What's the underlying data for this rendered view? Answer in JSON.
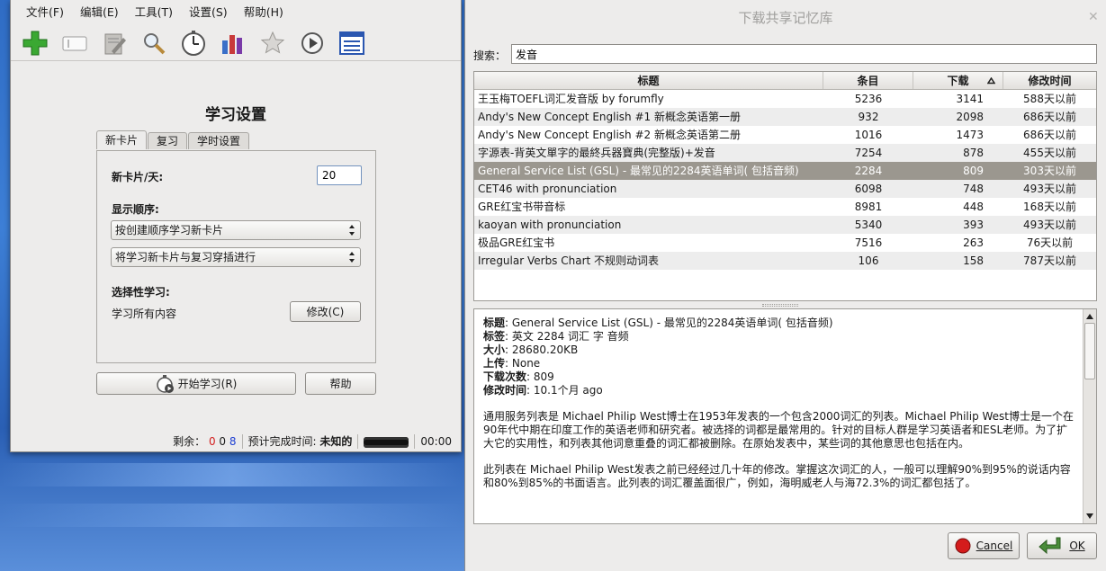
{
  "left_window": {
    "menu": [
      "文件(F)",
      "编辑(E)",
      "工具(T)",
      "设置(S)",
      "帮助(H)"
    ],
    "toolbar_icons": [
      "add-icon",
      "card-icon",
      "edit-icon",
      "search-icon",
      "timer-icon",
      "stats-icon",
      "star-icon",
      "play-icon",
      "list-icon"
    ],
    "title": "学习设置",
    "tabs": [
      "新卡片",
      "复习",
      "学时设置"
    ],
    "new_cards_label": "新卡片/天:",
    "new_cards_value": "20",
    "order_label": "显示顺序:",
    "order_option_1": "按创建顺序学习新卡片",
    "order_option_2": "将学习新卡片与复习穿插进行",
    "selective_label": "选择性学习:",
    "selective_value": "学习所有内容",
    "modify_button": "修改(C)",
    "start_button": "开始学习(R)",
    "help_button": "帮助",
    "status": {
      "remaining_label": "剩余：",
      "remaining_red": "0",
      "remaining_mid": "0",
      "remaining_blue": "8",
      "eta_label": "预计完成时间:",
      "eta_value": "未知的",
      "time": "00:00"
    }
  },
  "dialog": {
    "title": "下载共享记忆库",
    "search_label": "搜索：",
    "search_value": "发音",
    "columns": [
      "标题",
      "条目",
      "下载",
      "修改时间"
    ],
    "rows": [
      {
        "title": "王玉梅TOEFL词汇发音版 by forumfly",
        "count": "5236",
        "downloads": "3141",
        "modified": "588天以前"
      },
      {
        "title": "Andy's New Concept English #1 新概念英语第一册",
        "count": "932",
        "downloads": "2098",
        "modified": "686天以前"
      },
      {
        "title": "Andy's New Concept English #2 新概念英语第二册",
        "count": "1016",
        "downloads": "1473",
        "modified": "686天以前"
      },
      {
        "title": "字源表-背英文單字的最終兵器寶典(完整版)+发音",
        "count": "7254",
        "downloads": "878",
        "modified": "455天以前"
      },
      {
        "title": "General Service List (GSL) - 最常见的2284英语单词( 包括音频)",
        "count": "2284",
        "downloads": "809",
        "modified": "303天以前"
      },
      {
        "title": "CET46 with pronunciation",
        "count": "6098",
        "downloads": "748",
        "modified": "493天以前"
      },
      {
        "title": "GRE红宝书带音标",
        "count": "8981",
        "downloads": "448",
        "modified": "168天以前"
      },
      {
        "title": "kaoyan with pronunciation",
        "count": "5340",
        "downloads": "393",
        "modified": "493天以前"
      },
      {
        "title": "极品GRE红宝书",
        "count": "7516",
        "downloads": "263",
        "modified": "76天以前"
      },
      {
        "title": "Irregular Verbs Chart 不规则动词表",
        "count": "106",
        "downloads": "158",
        "modified": "787天以前"
      }
    ],
    "selected_row": 4,
    "details": {
      "title_label": "标题",
      "title_value": "General Service List (GSL) - 最常见的2284英语单词( 包括音频)",
      "tags_label": "标签",
      "tags_value": "英文 2284 词汇 字 音频",
      "size_label": "大小",
      "size_value": "28680.20KB",
      "upload_label": "上传",
      "upload_value": "None",
      "downloads_label": "下载次数",
      "downloads_value": "809",
      "modified_label": "修改时间",
      "modified_value": "10.1个月 ago",
      "para1": "通用服务列表是 Michael Philip West博士在1953年发表的一个包含2000词汇的列表。Michael Philip West博士是一个在90年代中期在印度工作的英语老师和研究者。被选择的词都是最常用的。针对的目标人群是学习英语者和ESL老师。为了扩大它的实用性，和列表其他词意重叠的词汇都被删除。在原始发表中，某些词的其他意思也包括在内。",
      "para2": "此列表在 Michael Philip West发表之前已经经过几十年的修改。掌握这次词汇的人，一般可以理解90%到95%的说话内容和80%到85%的书面语言。此列表的词汇覆盖面很广，例如，海明威老人与海72.3%的词汇都包括了。"
    },
    "cancel_button": "Cancel",
    "ok_button": "OK"
  }
}
